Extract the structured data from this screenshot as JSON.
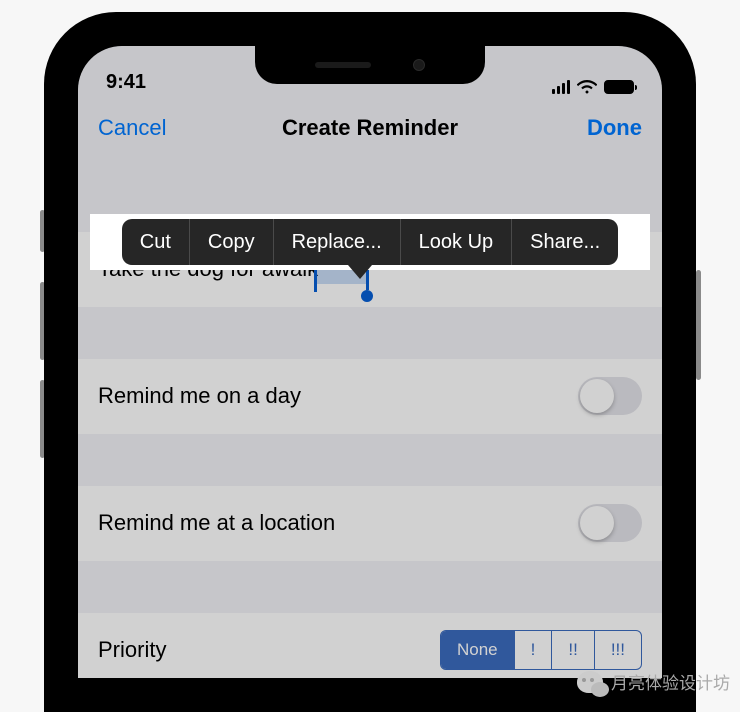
{
  "status": {
    "time": "9:41"
  },
  "nav": {
    "cancel": "Cancel",
    "title": "Create Reminder",
    "done": "Done"
  },
  "edit_menu": {
    "cut": "Cut",
    "copy": "Copy",
    "replace": "Replace...",
    "lookup": "Look Up",
    "share": "Share..."
  },
  "input": {
    "pre_text": "Take the dog for a ",
    "selected": "walk"
  },
  "rows": {
    "day": "Remind me on a day",
    "location": "Remind me at a location",
    "priority": "Priority"
  },
  "priority": {
    "none": "None",
    "p1": "!",
    "p2": "!!",
    "p3": "!!!"
  },
  "overlay": {
    "brand": "月亮体验设计坊"
  }
}
